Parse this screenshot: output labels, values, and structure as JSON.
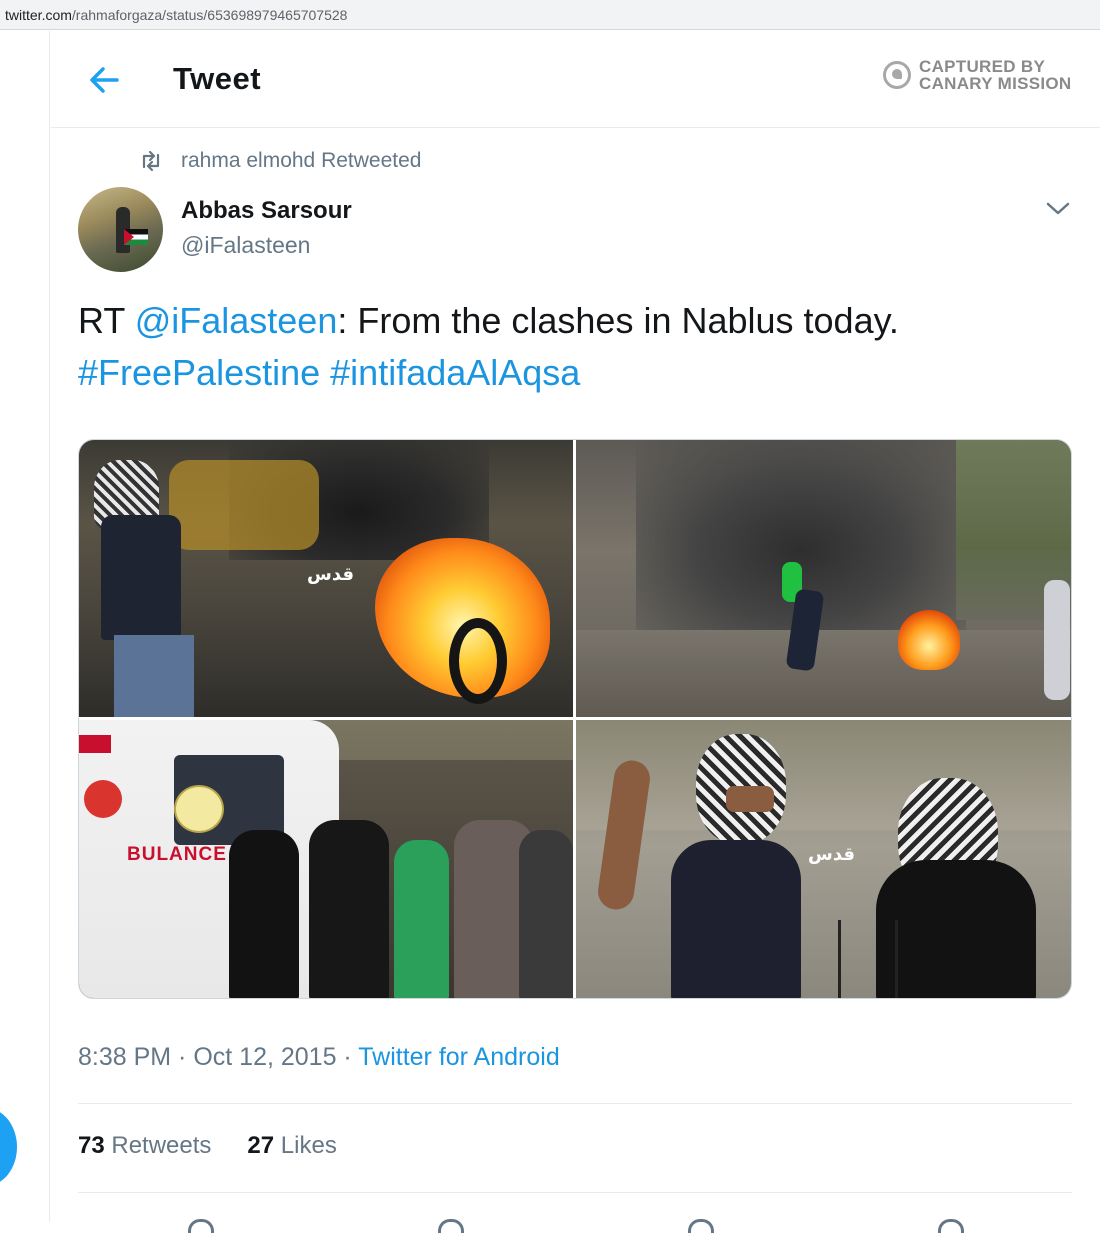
{
  "browser": {
    "url_host": "twitter.com",
    "url_path": "/rahmaforgaza/status/653698979465707528"
  },
  "header": {
    "title": "Tweet",
    "badge_line1": "CAPTURED BY",
    "badge_line2": "CANARY MISSION"
  },
  "retweet_context": {
    "text": "rahma elmohd Retweeted"
  },
  "author": {
    "name": "Abbas Sarsour",
    "handle": "@iFalasteen"
  },
  "tweet": {
    "prefix": "RT ",
    "mention": "@iFalasteen",
    "body": ": From the clashes in Nablus today.",
    "hashtag1": "#FreePalestine",
    "hashtag2": "#intifadaAlAqsa"
  },
  "media": {
    "watermark": "قدس",
    "ambulance_text": "BULANCE"
  },
  "meta": {
    "time": "8:38 PM",
    "sep1": " · ",
    "date": "Oct 12, 2015",
    "sep2": " · ",
    "source": "Twitter for Android"
  },
  "stats": {
    "retweets_count": "73",
    "retweets_label": " Retweets",
    "likes_count": "27",
    "likes_label": " Likes"
  },
  "colors": {
    "accent": "#1da1f2",
    "link": "#1b95e0",
    "muted": "#657786"
  }
}
